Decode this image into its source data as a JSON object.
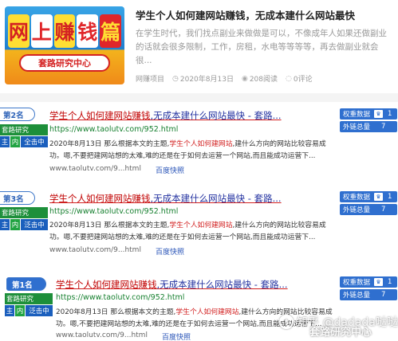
{
  "top_card": {
    "thumb_chars": [
      "网",
      "上",
      "赚",
      "钱",
      "篇"
    ],
    "thumb_caption": "套路研究中心",
    "title": "学生个人如何建网站赚钱，无成本建什么网站最快",
    "description": "在学生时代，我们找点副业来做做是可以，不像成年人如果还做副业的话就会很多限制，工作，房租，水电等等等等，再去做副业就会很...",
    "category": "网赚项目",
    "date": "2020年8月13日",
    "views": "208阅读",
    "comments": "0评论"
  },
  "results": [
    {
      "rank": "第2名",
      "badge_top": "套路研究",
      "badge_zhu": "主",
      "badge_nei": "内",
      "badge_quan": "全击中",
      "title_hl": "学生个人如何建网站赚钱",
      "title_rest": ",无成本建什么网站最快 - 套路...",
      "url": "https://www.taolutv.com/952.html",
      "desc_a": "2020年8月13日  那么根据本文的主题,",
      "desc_red": "学生个人如何建网站",
      "desc_b": ",建什么方向的网站比较容易成功。嗯,不要把建网站想的太难,难的还是在于如何去运营一个网站,而且能成功运营下...",
      "foot_url": "www.taolutv.com/9...html",
      "snapshot": "百度快照",
      "weight_label": "权重数据",
      "weight_val": "1",
      "links_label": "外链总量",
      "links_val": "7"
    },
    {
      "rank": "第3名",
      "badge_top": "套路研究",
      "badge_zhu": "主",
      "badge_nei": "内",
      "badge_quan": "泛击中",
      "title_hl": "学生个人如何建网站赚钱",
      "title_rest": ",无成本建什么网站最快 - 套路...",
      "url": "https://www.taolutv.com/952.html",
      "desc_a": "2020年8月13日  那么根据本文的主题,",
      "desc_red": "学生个人如何建网站",
      "desc_b": ",建什么方向的网站比较容易成功。嗯,不要把建网站想的太难,难的还是在于如何去运营一个网站,而且能成功运营下...",
      "foot_url": "www.taolutv.com/9...html",
      "snapshot": "百度快照",
      "weight_label": "权重数据",
      "weight_val": "1",
      "links_label": "外链总量",
      "links_val": "7"
    },
    {
      "rank": "第1名",
      "badge_top": "套路研究",
      "badge_zhu": "主",
      "badge_nei": "内",
      "badge_quan": "泛击中",
      "title_hl": "学生个人如何建网站赚钱",
      "title_rest": ",无成本建什么网站最快 - 套路...",
      "url": "https://www.taolutv.com/952.html",
      "desc_a": "2020年8月13日  那么根据本文的主题,",
      "desc_red": "学生个人如何建网站",
      "desc_b": ",建什么方向的网站比较容易成功。嗯,不要把建网站想的太难,难的还是在于如何去运营一个网站,而且能成功运营下...",
      "foot_url": "www.taolutv.com/9...html",
      "snapshot": "百度快照",
      "weight_label": "权重数据",
      "weight_val": "1",
      "links_label": "外链总量",
      "links_val": "7"
    }
  ],
  "watermark": {
    "line1": "知乎 @dadada哒哒哒",
    "line2": "套路研究中心"
  },
  "colors": {
    "title_red": "#d21f1f",
    "url_green": "#178030",
    "badge_blue": "#2f6fcf",
    "badge_green": "#1d8f3a"
  }
}
